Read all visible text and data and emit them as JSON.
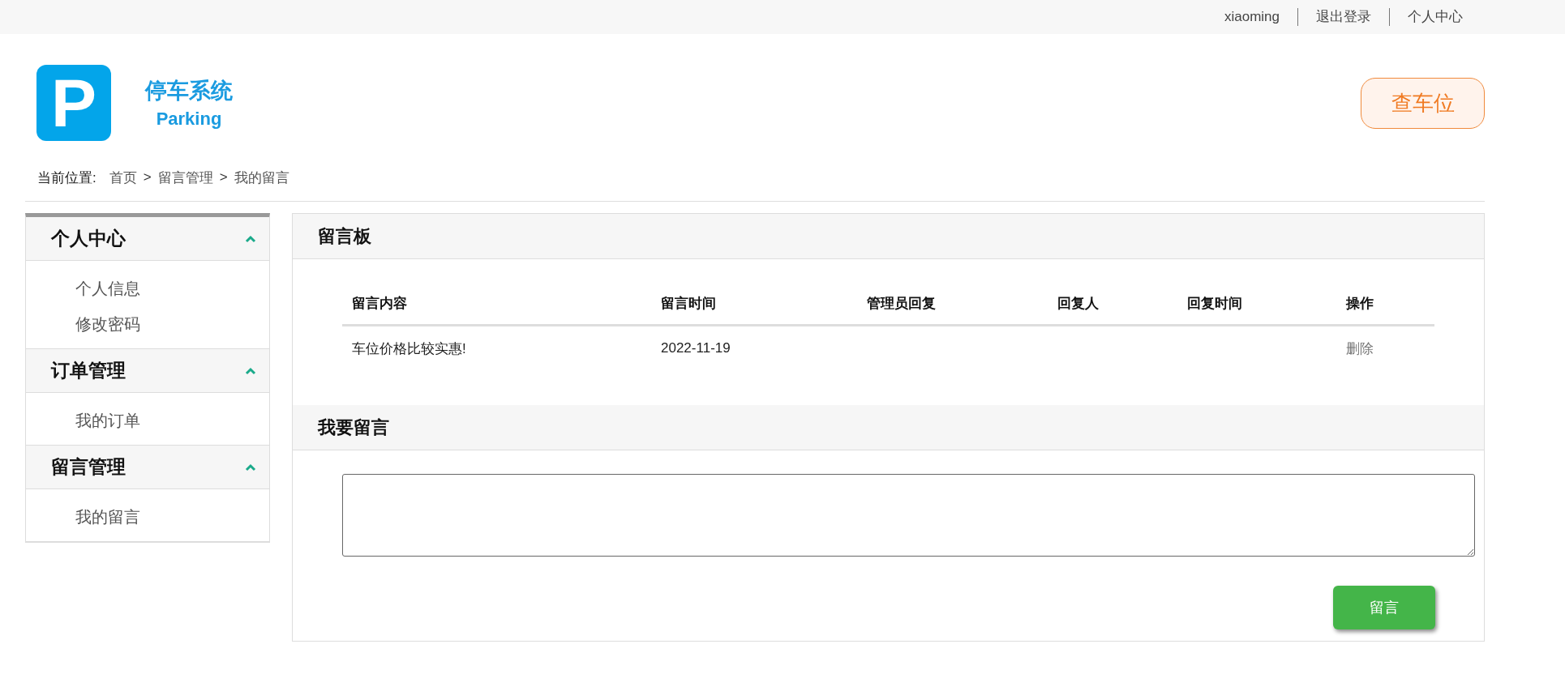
{
  "top_bar": {
    "links": [
      "xiaoming",
      "退出登录",
      "个人中心"
    ]
  },
  "logo": {
    "letter": "P",
    "title": "停车系统",
    "subtitle": "Parking"
  },
  "search_button": "查车位",
  "breadcrumb": {
    "label": "当前位置:",
    "items": [
      "首页",
      "留言管理",
      "我的留言"
    ],
    "separator": ">"
  },
  "sidebar": {
    "groups": [
      {
        "title": "个人中心",
        "expanded": true,
        "items": [
          "个人信息",
          "修改密码"
        ]
      },
      {
        "title": "订单管理",
        "expanded": true,
        "items": [
          "我的订单"
        ]
      },
      {
        "title": "留言管理",
        "expanded": true,
        "items": [
          "我的留言"
        ]
      }
    ]
  },
  "board": {
    "title": "留言板",
    "columns": [
      "留言内容",
      "留言时间",
      "管理员回复",
      "回复人",
      "回复时间",
      "操作"
    ],
    "rows": [
      {
        "cells": [
          "车位价格比较实惠!",
          "2022-11-19",
          "",
          "",
          "",
          ""
        ],
        "action": "删除"
      }
    ]
  },
  "compose": {
    "title": "我要留言",
    "submit": "留言"
  }
}
